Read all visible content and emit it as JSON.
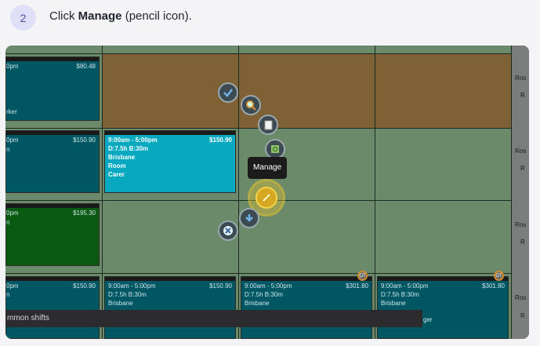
{
  "step": {
    "number": "2",
    "text_prefix": "Click ",
    "text_bold": "Manage",
    "text_suffix": " (pencil icon)."
  },
  "roster": {
    "row1": {
      "col1_price": "$80.48",
      "col1_time": "0pm",
      "col1_role": "rker"
    },
    "row2": {
      "col1_price": "$150.90",
      "col1_time": "0pm",
      "col1_loc": "n",
      "shift_time": "9:00am - 5:00pm",
      "shift_price": "$150.90",
      "shift_hours": "D:7.5h B:30m",
      "shift_location": "Brisbane",
      "shift_area": "Room",
      "shift_role": "Carer"
    },
    "row3": {
      "col1_price": "$195.30",
      "col1_time": "0pm",
      "col1_loc": "n"
    },
    "row4": {
      "col1_price": "$150.90",
      "col1_time": "0pm",
      "col1_loc": "n",
      "c2_time": "9:00am - 5:00pm",
      "c2_price": "$150.90",
      "c2_hours": "D:7.5h B:30m",
      "c2_location": "Brisbane",
      "c3_time": "9:00am - 5:00pm",
      "c3_price": "$301.80",
      "c3_hours": "D:7.5h B:30m",
      "c3_location": "Brisbane",
      "c4_time": "9:00am - 5:00pm",
      "c4_price": "$301.80",
      "c4_hours": "D:7.5h B:30m",
      "c4_location": "Brisbane",
      "c4_role": "ger",
      "ot_label": "OT"
    },
    "right_col": [
      "Ros",
      "R",
      "Ros",
      "R",
      "Ros",
      "R",
      "Ros",
      "R"
    ]
  },
  "tooltip": "Manage",
  "footer": "mmon shifts",
  "icons": [
    "check-icon",
    "search-icon",
    "notes-icon",
    "email-icon",
    "pencil-icon",
    "download-icon",
    "close-icon"
  ]
}
